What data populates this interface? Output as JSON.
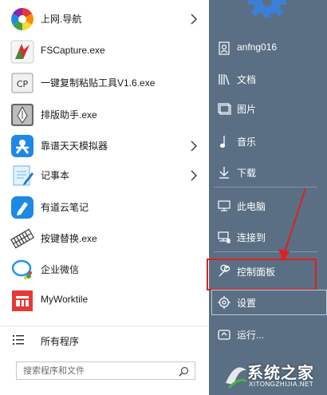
{
  "programs": [
    {
      "label": "上网.导航",
      "icon": "navigation-pinwheel-icon",
      "has_submenu": true
    },
    {
      "label": "FSCapture.exe",
      "icon": "fscapture-icon",
      "has_submenu": false
    },
    {
      "label": "一键复制粘贴工具V1.6.exe",
      "icon": "cp-tool-icon",
      "has_submenu": false
    },
    {
      "label": "排版助手.exe",
      "icon": "pen-nib-icon",
      "has_submenu": false
    },
    {
      "label": "靠谱天天模拟器",
      "icon": "emulator-icon",
      "has_submenu": true
    },
    {
      "label": "记事本",
      "icon": "notepad-icon",
      "has_submenu": true
    },
    {
      "label": "有道云笔记",
      "icon": "youdao-note-icon",
      "has_submenu": false
    },
    {
      "label": "按键替换.exe",
      "icon": "keyboard-icon",
      "has_submenu": false
    },
    {
      "label": "企业微信",
      "icon": "wecom-icon",
      "has_submenu": false
    },
    {
      "label": "MyWorktile",
      "icon": "worktile-icon",
      "has_submenu": false
    }
  ],
  "all_programs": {
    "label": "所有程序",
    "icon": "list-icon"
  },
  "search": {
    "placeholder": "搜索程序和文件",
    "icon": "search-icon"
  },
  "right_items": [
    {
      "label": "anfng016",
      "icon": "user-folder-icon"
    },
    {
      "label": "文档",
      "icon": "library-icon"
    },
    {
      "label": "图片",
      "icon": "picture-icon"
    },
    {
      "label": "音乐",
      "icon": "music-icon"
    },
    {
      "label": "下载",
      "icon": "download-icon"
    },
    {
      "label": "此电脑",
      "icon": "computer-icon"
    },
    {
      "label": "连接到",
      "icon": "network-icon"
    },
    {
      "label": "控制面板",
      "icon": "wrench-icon"
    },
    {
      "label": "设置",
      "icon": "gear-icon"
    },
    {
      "label": "运行...",
      "icon": "run-icon"
    }
  ],
  "watermark": {
    "text": "系统之家",
    "url": "XITONGZHIJIA.NET"
  },
  "colors": {
    "right_panel_bg": "#5a6f83",
    "left_panel_bg": "#ffffff",
    "highlight": "#e02020"
  }
}
